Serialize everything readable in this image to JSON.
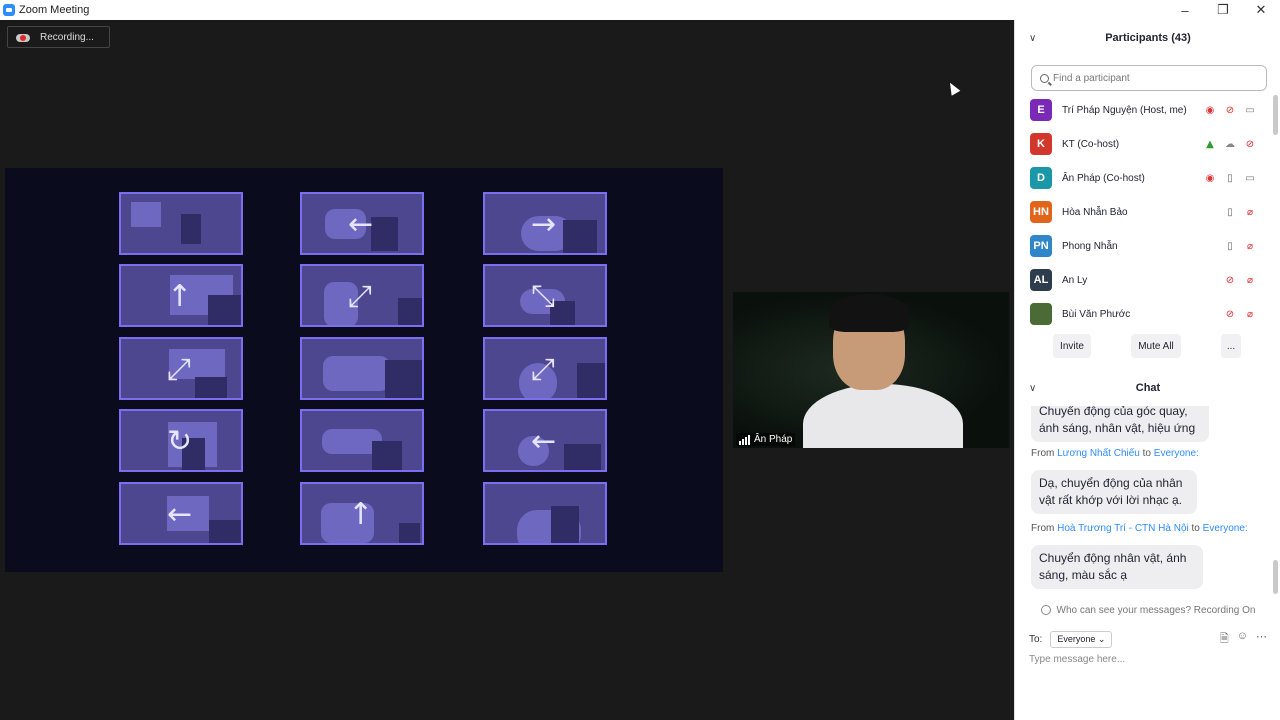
{
  "window": {
    "title": "Zoom Meeting"
  },
  "recording": {
    "label": "Recording..."
  },
  "camera": {
    "name": "Ân Pháp"
  },
  "participants": {
    "header": "Participants (43)",
    "search_placeholder": "Find a participant",
    "list": [
      {
        "initials": "E",
        "color": "#7b2ab8",
        "name": "Trí Pháp Nguyện (Host, me)",
        "icons": [
          "rec",
          "mute",
          "video"
        ]
      },
      {
        "initials": "K",
        "color": "#d1372b",
        "name": "KT (Co-host)",
        "icons": [
          "share",
          "cloud",
          "mute"
        ]
      },
      {
        "initials": "D",
        "color": "#1a98a8",
        "name": "Ân Pháp (Co-host)",
        "icons": [
          "rec",
          "mic",
          "video"
        ]
      },
      {
        "initials": "HN",
        "color": "#e0651a",
        "name": "Hòa Nhẫn Bảo",
        "icons": [
          "mic",
          "videooff"
        ]
      },
      {
        "initials": "PN",
        "color": "#2f86c9",
        "name": "Phong Nhẫn",
        "icons": [
          "mic",
          "videooff"
        ]
      },
      {
        "initials": "AL",
        "color": "#2e3d4d",
        "name": "An Ly",
        "icons": [
          "mute",
          "videooff"
        ]
      },
      {
        "initials": "",
        "color": "#4a6b35",
        "name": "Bùi Văn Phước",
        "icons": [
          "mute",
          "videooff"
        ]
      }
    ],
    "buttons": {
      "invite": "Invite",
      "mute_all": "Mute All",
      "more": "..."
    }
  },
  "chat": {
    "header": "Chat",
    "msg0_text": "Chuyển động của góc quay, ánh sáng, nhân vật, hiệu ứng",
    "msg1_from": "From",
    "msg1_sender": "Lương Nhất Chiếu",
    "msg1_to": "to",
    "msg1_target": "Everyone:",
    "msg1_text": "Dạ, chuyển động của nhân vật rất khớp với lời nhạc ạ.",
    "msg2_from": "From",
    "msg2_sender": "Hoà Trương Trí - CTN Hà Nội",
    "msg2_to": "to",
    "msg2_target": "Everyone:",
    "msg2_text": "Chuyển động nhân vật, ánh sáng, màu sắc ạ",
    "who_can_see": "Who can see your messages? Recording On",
    "to_label": "To:",
    "to_value": "Everyone",
    "placeholder": "Type message here..."
  },
  "colors": {
    "accent": "#2d8cff",
    "panel_border": "#7b6ef0",
    "panel_fill": "#4d4790"
  }
}
